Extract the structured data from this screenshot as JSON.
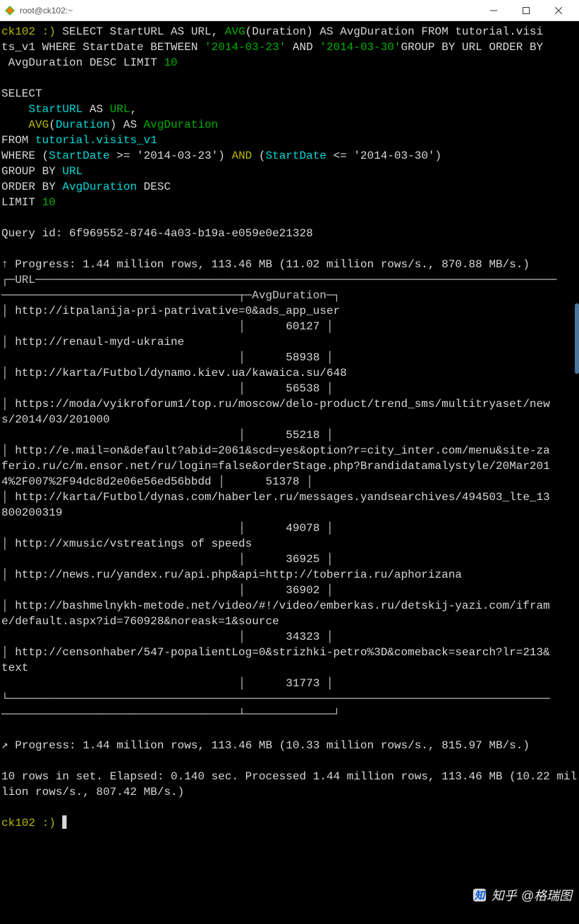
{
  "titlebar": {
    "title": "root@ck102:~"
  },
  "terminal": {
    "prompt_host": "ck102 :) ",
    "query_inline": {
      "seg1": "SELECT StartURL AS URL, ",
      "avg": "AVG",
      "seg1b": "(Duration) AS AvgDuration FROM tutorial.visi",
      "seg2": "ts_v1 WHERE StartDate BETWEEN ",
      "d1": "'2014-03-23'",
      "and": " AND ",
      "d2": "'2014-03-30'",
      "seg3": "GROUP BY URL ORDER BY",
      "seg4": " AvgDuration DESC LIMIT ",
      "ten": "10"
    },
    "query_pretty": {
      "l1": "SELECT",
      "l2a": "    ",
      "l2b": "StartURL",
      "l2c": " AS ",
      "l2d": "URL",
      "l2e": ",",
      "l3a": "    ",
      "l3b": "AVG",
      "l3c": "(",
      "l3d": "Duration",
      "l3e": ") AS ",
      "l3f": "AvgDuration",
      "l4a": "FROM ",
      "l4b": "tutorial.visits_v1",
      "l5a": "WHERE (",
      "l5b": "StartDate",
      "l5c": " >= ",
      "l5d": "'2014-03-23'",
      "l5e": ") ",
      "l5and": "AND",
      "l5f": " (",
      "l5g": "StartDate",
      "l5h": " <= ",
      "l5i": "'2014-03-30'",
      "l5j": ")",
      "l6a": "GROUP BY ",
      "l6b": "URL",
      "l7a": "ORDER BY ",
      "l7b": "AvgDuration",
      "l7c": " DESC",
      "l8a": "LIMIT ",
      "l8b": "10"
    },
    "query_id": "Query id: 6f969552-8746-4a03-b19a-e059e0e21328",
    "progress1": "↑ Progress: 1.44 million rows, 113.46 MB (11.02 million rows/s., 870.88 MB/s.)",
    "header_url": "URL",
    "header_avg": "AvgDuration",
    "rows": [
      {
        "url": "http://itpalanija-pri-patrivative=0&ads_app_user",
        "val": "60127"
      },
      {
        "url": "http://renaul-myd-ukraine",
        "val": "58938"
      },
      {
        "url": "http://karta/Futbol/dynamo.kiev.ua/kawaica.su/648",
        "val": "56538"
      },
      {
        "url": "https://moda/vyikroforum1/top.ru/moscow/delo-product/trend_sms/multitryaset/news/2014/03/201000",
        "val": "55218"
      },
      {
        "url": "http://e.mail=on&default?abid=2061&scd=yes&option?r=city_inter.com/menu&site-zaferio.ru/c/m.ensor.net/ru/login=false&orderStage.php?Brandidatamalystyle/20Mar2014%2F007%2F94dc8d2e06e56ed56bbdd",
        "val": "51378"
      },
      {
        "url": "http://karta/Futbol/dynas.com/haberler.ru/messages.yandsearchives/494503_lte_13800200319",
        "val": "49078"
      },
      {
        "url": "http://xmusic/vstreatings of speeds",
        "val": "36925"
      },
      {
        "url": "http://news.ru/yandex.ru/api.php&api=http://toberria.ru/aphorizana",
        "val": "36902"
      },
      {
        "url": "http://bashmelnykh-metode.net/video/#!/video/emberkas.ru/detskij-yazi.com/iframe/default.aspx?id=760928&noreask=1&source",
        "val": "34323"
      },
      {
        "url": "http://censonhaber/547-popalientLog=0&strizhki-petro%3D&comeback=search?lr=213&text",
        "val": "31773"
      }
    ],
    "progress2": "↗ Progress: 1.44 million rows, 113.46 MB (10.33 million rows/s., 815.97 MB/s.)",
    "resultline": "10 rows in set. Elapsed: 0.140 sec. Processed 1.44 million rows, 113.46 MB (10.22 million rows/s., 807.42 MB/s.)",
    "prompt2": "ck102 :) ",
    "cursor": "▋"
  },
  "watermark": {
    "brand": "知乎",
    "author": "@格瑞图"
  }
}
